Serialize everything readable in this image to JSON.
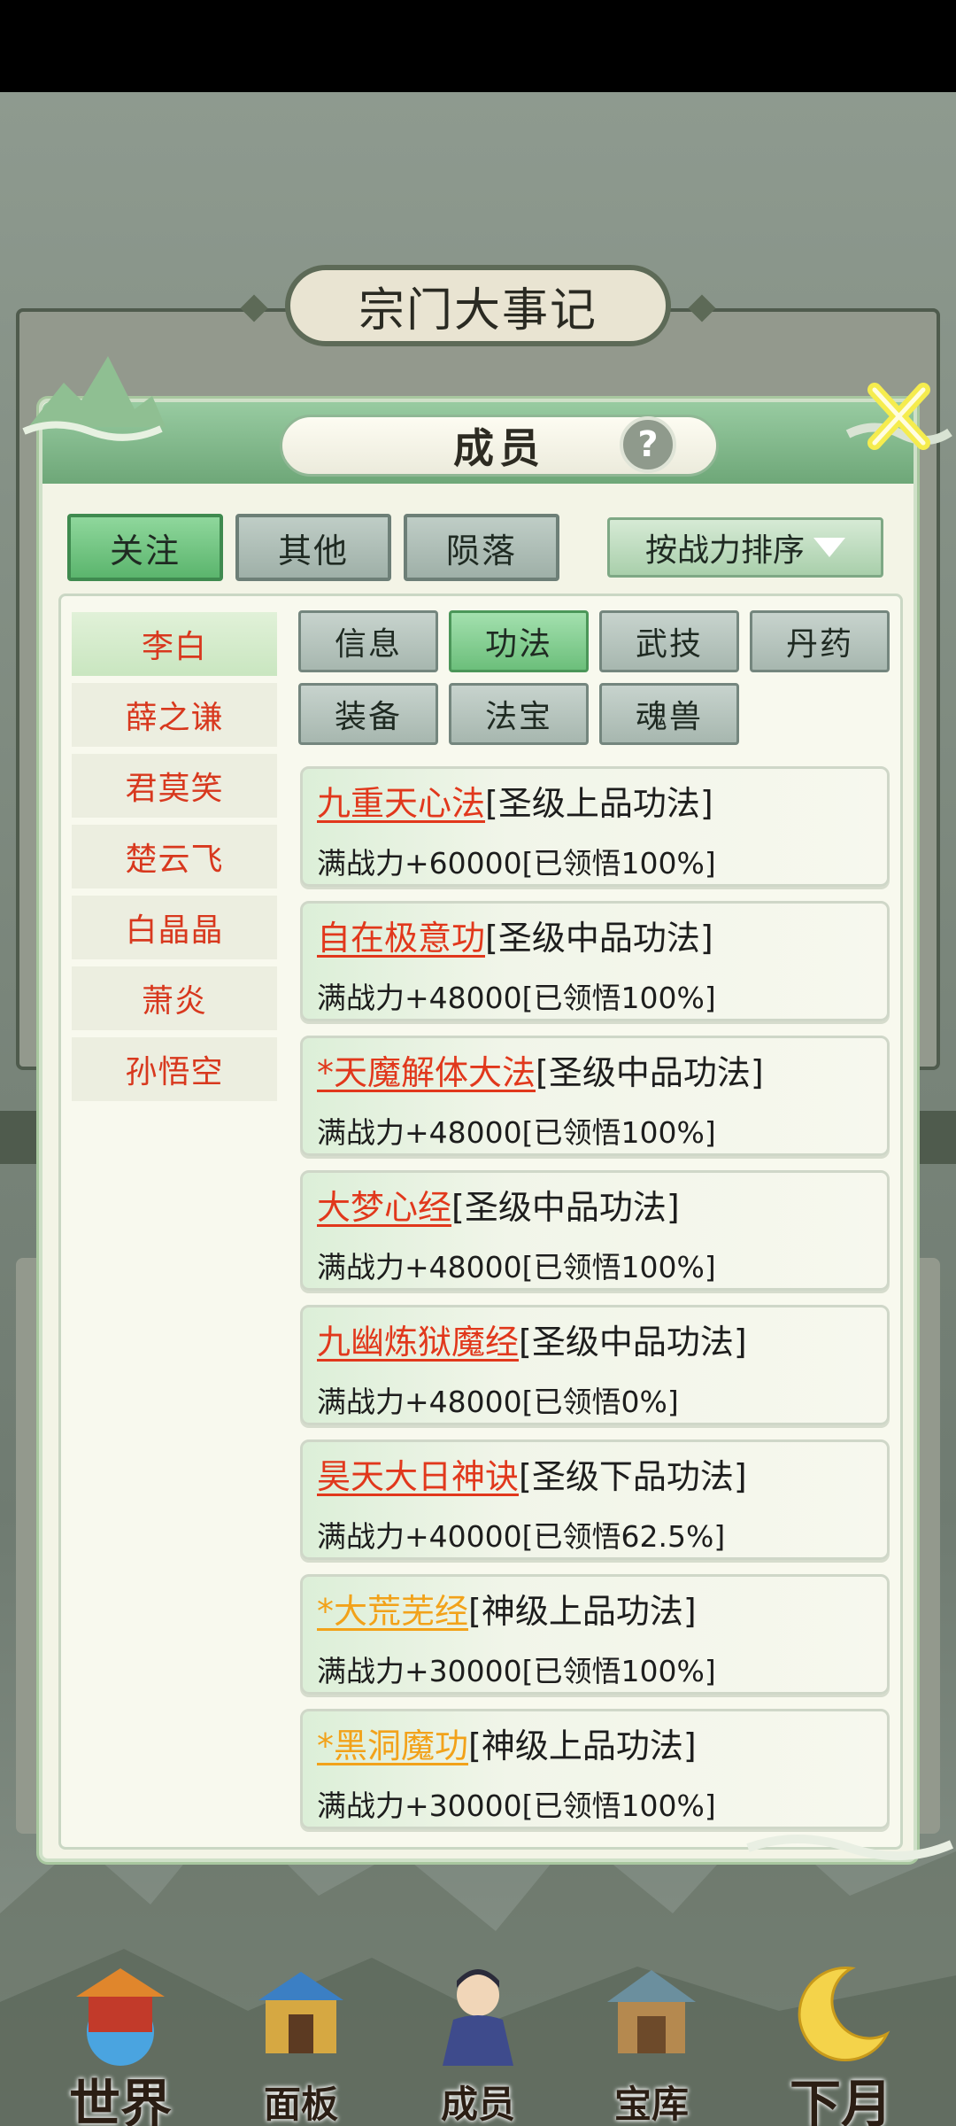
{
  "background": {
    "title": "宗门大事记"
  },
  "dialog": {
    "title": "成员",
    "help_label": "?"
  },
  "tabs": [
    {
      "label": "关注",
      "active": true
    },
    {
      "label": "其他",
      "active": false
    },
    {
      "label": "陨落",
      "active": false
    }
  ],
  "sort": {
    "label": "按战力排序"
  },
  "members": [
    {
      "name": "李白",
      "active": true
    },
    {
      "name": "薛之谦",
      "active": false
    },
    {
      "name": "君莫笑",
      "active": false
    },
    {
      "name": "楚云飞",
      "active": false
    },
    {
      "name": "白晶晶",
      "active": false
    },
    {
      "name": "萧炎",
      "active": false
    },
    {
      "name": "孙悟空",
      "active": false
    }
  ],
  "subtabs": [
    {
      "label": "信息",
      "active": false
    },
    {
      "label": "功法",
      "active": true
    },
    {
      "label": "武技",
      "active": false
    },
    {
      "label": "丹药",
      "active": false
    },
    {
      "label": "装备",
      "active": false
    },
    {
      "label": "法宝",
      "active": false
    },
    {
      "label": "魂兽",
      "active": false
    }
  ],
  "skills": [
    {
      "name": "九重天心法",
      "grade": "[圣级上品功法]",
      "stat": "满战力+60000[已领悟100%]",
      "color": "red"
    },
    {
      "name": "自在极意功",
      "grade": "[圣级中品功法]",
      "stat": "满战力+48000[已领悟100%]",
      "color": "red"
    },
    {
      "name": "*天魔解体大法",
      "grade": "[圣级中品功法]",
      "stat": "满战力+48000[已领悟100%]",
      "color": "red"
    },
    {
      "name": "大梦心经",
      "grade": "[圣级中品功法]",
      "stat": "满战力+48000[已领悟100%]",
      "color": "red"
    },
    {
      "name": "九幽炼狱魔经",
      "grade": "[圣级中品功法]",
      "stat": "满战力+48000[已领悟0%]",
      "color": "red"
    },
    {
      "name": "昊天大日神诀",
      "grade": "[圣级下品功法]",
      "stat": "满战力+40000[已领悟62.5%]",
      "color": "red"
    },
    {
      "name": "*大荒芜经",
      "grade": "[神级上品功法]",
      "stat": "满战力+30000[已领悟100%]",
      "color": "gold"
    },
    {
      "name": "*黑洞魔功",
      "grade": "[神级上品功法]",
      "stat": "满战力+30000[已领悟100%]",
      "color": "gold"
    }
  ],
  "nav": [
    {
      "label": "世界",
      "icon": "palace-icon"
    },
    {
      "label": "面板",
      "icon": "gate-icon"
    },
    {
      "label": "成员",
      "icon": "character-icon"
    },
    {
      "label": "宝库",
      "icon": "treasury-icon"
    },
    {
      "label": "下月",
      "icon": "moon-icon"
    }
  ]
}
